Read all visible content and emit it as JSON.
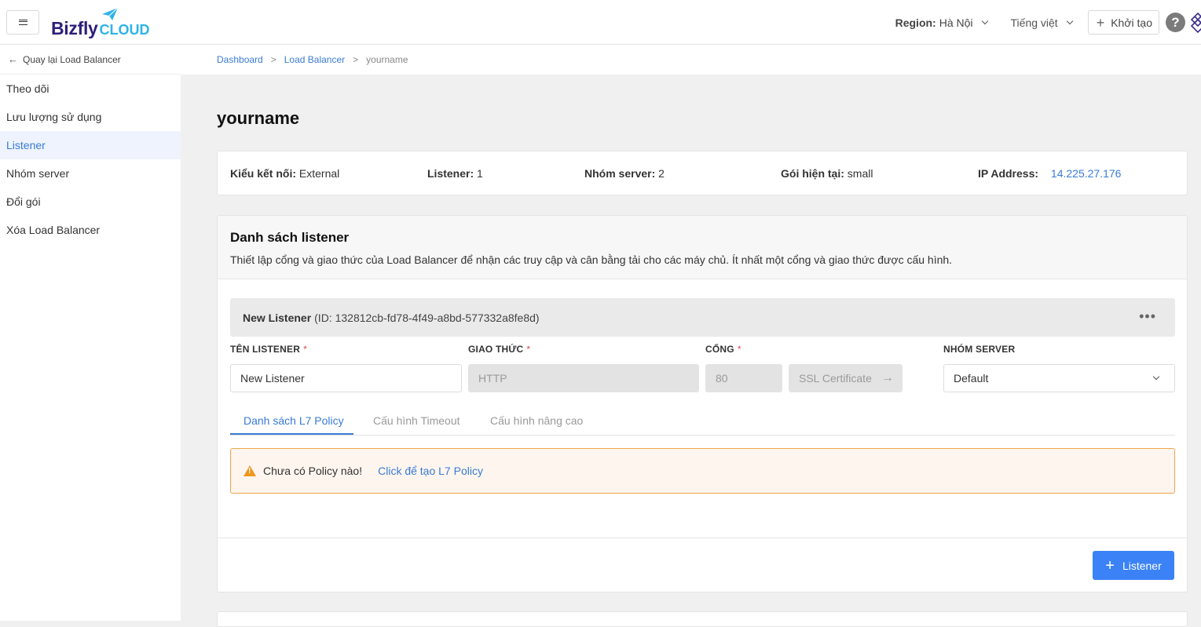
{
  "header": {
    "logo_main": "Bizfly",
    "logo_sub": "CLOUD",
    "region_label": "Region:",
    "region_value": "Hà Nội",
    "language": "Tiếng việt",
    "create_label": "Khởi tạo",
    "help_symbol": "?"
  },
  "sidebar": {
    "back_label": "Quay lại Load Balancer",
    "items": [
      {
        "label": "Theo dõi"
      },
      {
        "label": "Lưu lượng sử dụng"
      },
      {
        "label": "Listener"
      },
      {
        "label": "Nhóm server"
      },
      {
        "label": "Đổi gói"
      },
      {
        "label": "Xóa Load Balancer"
      }
    ],
    "active_index": 2
  },
  "breadcrumb": {
    "items": [
      "Dashboard",
      "Load Balancer",
      "yourname"
    ],
    "separator": ">"
  },
  "page": {
    "title": "yourname"
  },
  "info": {
    "conn_type_label": "Kiểu kết nối:",
    "conn_type_value": "External",
    "listener_label": "Listener:",
    "listener_value": "1",
    "server_group_label": "Nhóm server:",
    "server_group_value": "2",
    "plan_label": "Gói hiện tại:",
    "plan_value": "small",
    "ip_label": "IP Address:",
    "ip_value": "14.225.27.176"
  },
  "listener_list": {
    "title": "Danh sách listener",
    "description": "Thiết lập cổng và giao thức của Load Balancer để nhận các truy cập và cân bằng tải cho các máy chủ. Ít nhất một cổng và giao thức được cấu hình.",
    "listener": {
      "name": "New Listener",
      "id_text": "(ID: 132812cb-fd78-4f49-a8bd-577332a8fe8d)",
      "more_symbol": "•••"
    },
    "fields": {
      "name_label": "TÊN LISTENER",
      "name_value": "New Listener",
      "protocol_label": "GIAO THỨC",
      "protocol_value": "HTTP",
      "port_label": "CỔNG",
      "port_value": "80",
      "ssl_label": "SSL Certificate",
      "server_group_label": "NHÓM SERVER",
      "server_group_value": "Default",
      "required_mark": "*"
    },
    "tabs": [
      {
        "label": "Danh sách L7 Policy"
      },
      {
        "label": "Cấu hình Timeout"
      },
      {
        "label": "Cấu hình nâng cao"
      }
    ],
    "alert": {
      "message": "Chưa có Policy nào!",
      "action": "Click để tạo L7 Policy"
    },
    "add_button": "Listener"
  },
  "colors": {
    "primary": "#3b82f6",
    "link": "#3a7bd5",
    "warning": "#f0961e",
    "required": "#e04848"
  }
}
